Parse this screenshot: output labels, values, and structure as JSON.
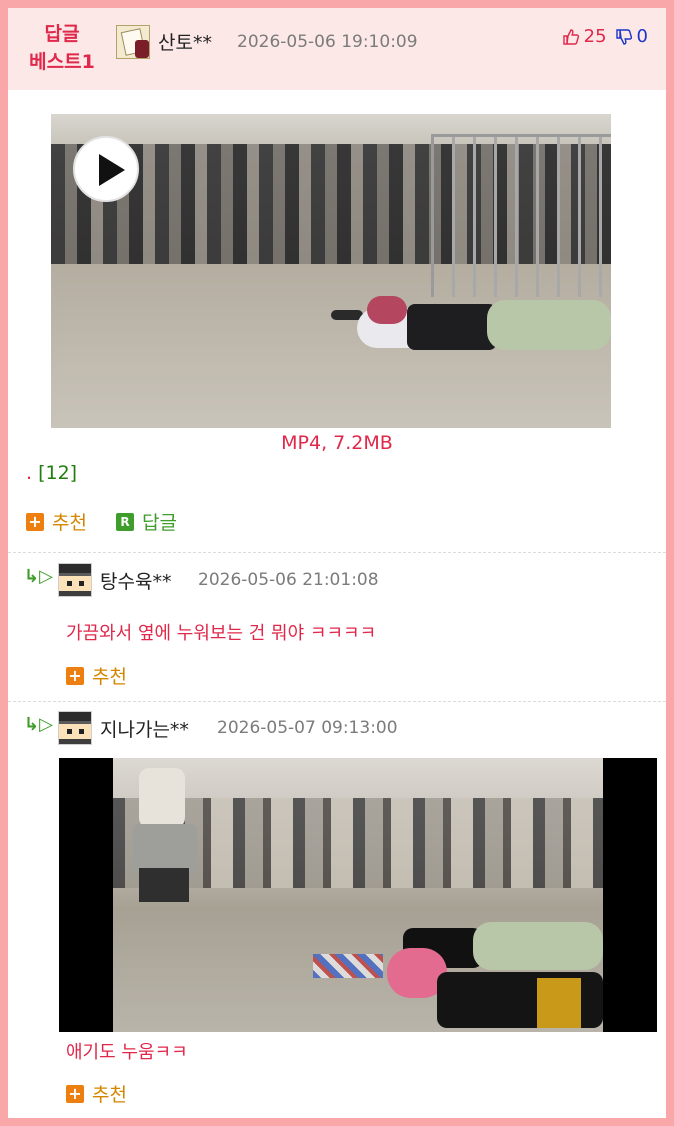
{
  "best_reply": {
    "badge_line1": "답글",
    "badge_line2": "베스트1",
    "nickname": "산토**",
    "datetime": "2026-05-06 19:10:09",
    "upvotes": "25",
    "downvotes": "0",
    "video_caption": "MP4,  7.2MB",
    "text_dot": ".",
    "text_count": "[12]",
    "recommend_label": "추천",
    "reply_label": "답글",
    "reply_icon_letter": "R"
  },
  "comments": [
    {
      "nickname": "탕수육**",
      "datetime": "2026-05-06 21:01:08",
      "text": "가끔와서 옆에 누워보는 건 뭐야 ㅋㅋㅋㅋ",
      "recommend_label": "추천"
    },
    {
      "nickname": "지나가는**",
      "datetime": "2026-05-07 09:13:00",
      "text": "애기도 누움ㅋㅋ",
      "recommend_label": "추천"
    }
  ],
  "icons": {
    "reply_arrow": "↳▷",
    "plus": "+",
    "thumbs_up": "thumbs-up-icon",
    "thumbs_down": "thumbs-down-icon",
    "play": "play-icon"
  },
  "colors": {
    "border": "#f9a7a9",
    "header_bg": "#fde8e8",
    "accent_red": "#e0284b",
    "green": "#3f9d2b",
    "orange": "#d48600",
    "blue": "#1a35c9"
  }
}
